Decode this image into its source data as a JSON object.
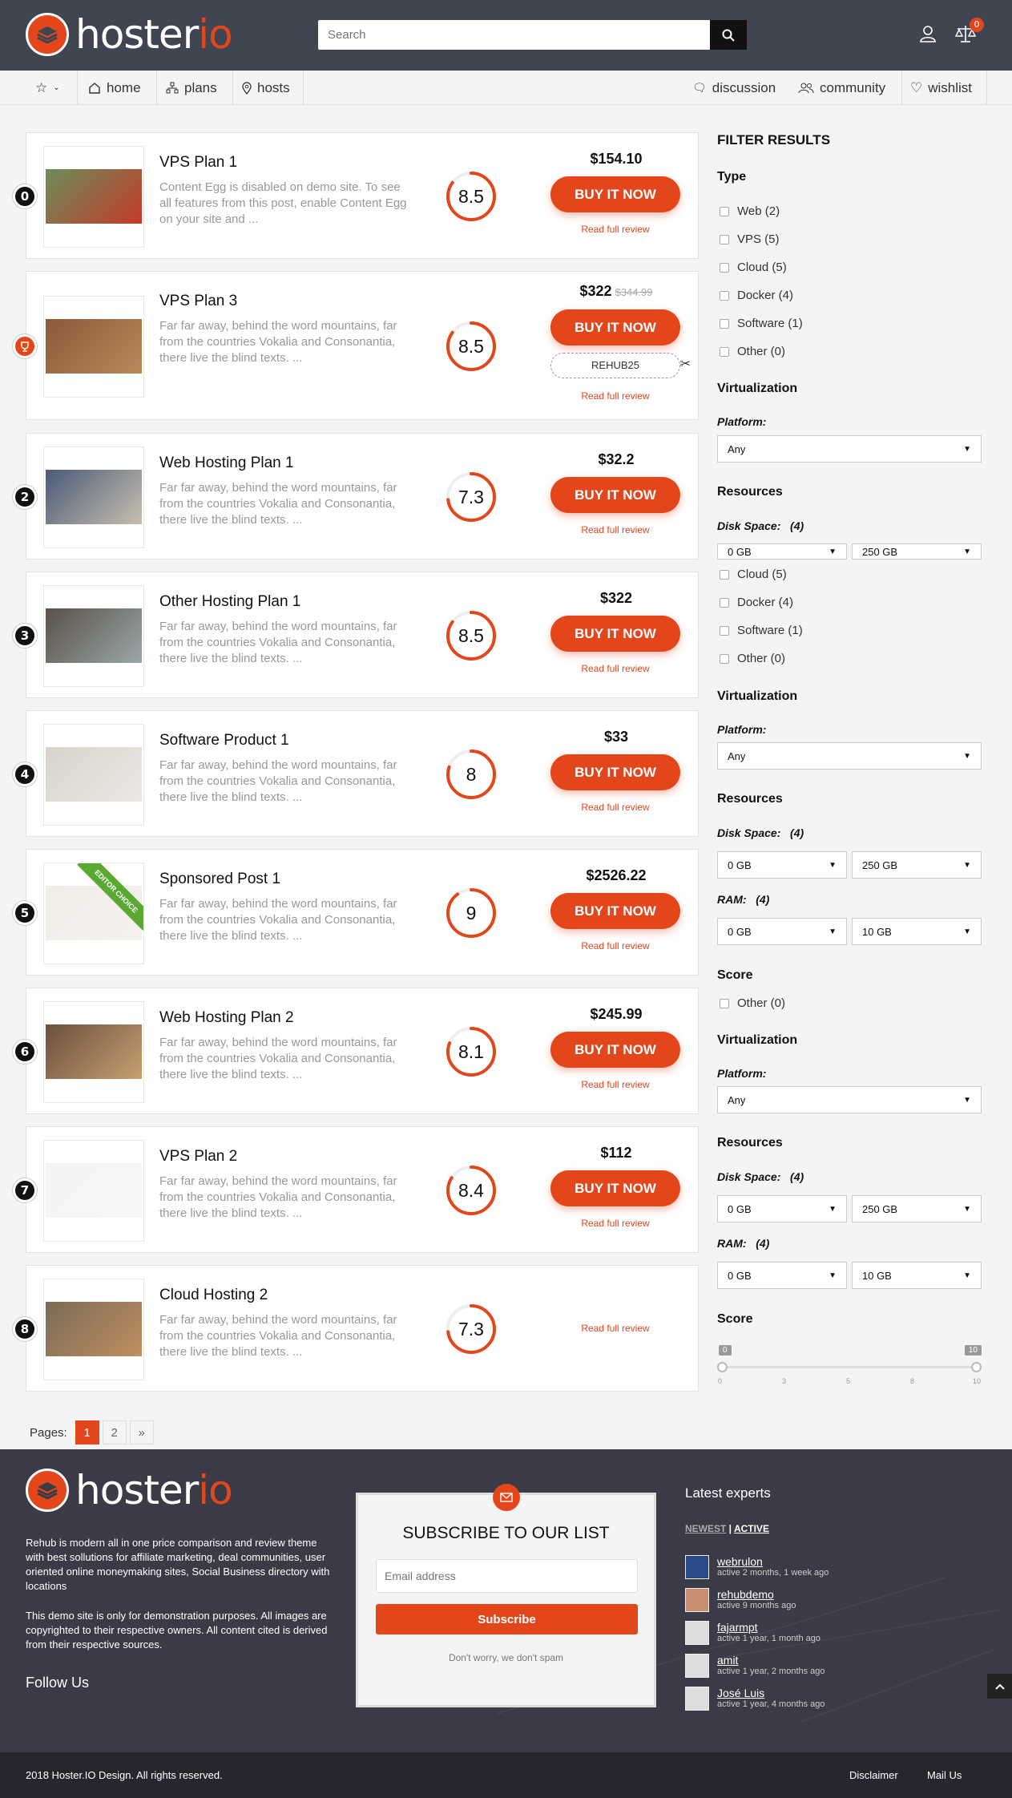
{
  "header": {
    "logo_main": "hoster",
    "logo_accent": "io",
    "search_placeholder": "Search",
    "cart_count": "0"
  },
  "nav": {
    "left": [
      {
        "label": "home",
        "icon": "home-icon"
      },
      {
        "label": "plans",
        "icon": "sitemap-icon"
      },
      {
        "label": "hosts",
        "icon": "map-pin-icon"
      }
    ],
    "right": [
      {
        "label": "discussion",
        "icon": "chat-icon"
      },
      {
        "label": "community",
        "icon": "users-icon"
      },
      {
        "label": "wishlist",
        "icon": "heart-icon"
      }
    ]
  },
  "products": [
    {
      "rank": "0",
      "title": "VPS Plan 1",
      "desc": "Content Egg is disabled on demo site. To see all features from this post, enable Content Egg on your site and ...",
      "score": "8.5",
      "score_value": 8.5,
      "price": "$154.10",
      "old_price": "",
      "buy": "BUY IT NOW",
      "coupon": "",
      "review": "Read full review"
    },
    {
      "rank": "",
      "title": "VPS Plan 3",
      "desc": "Far far away, behind the word mountains, far from the countries Vokalia and Consonantia, there live the blind texts. ...",
      "score": "8.5",
      "score_value": 8.5,
      "price": "$322",
      "old_price": "$344.99",
      "buy": "BUY IT NOW",
      "coupon": "REHUB25",
      "review": "Read full review"
    },
    {
      "rank": "2",
      "title": "Web Hosting Plan 1",
      "desc": "Far far away, behind the word mountains, far from the countries Vokalia and Consonantia, there live the blind texts. ...",
      "score": "7.3",
      "score_value": 7.3,
      "price": "$32.2",
      "old_price": "",
      "buy": "BUY IT NOW",
      "coupon": "",
      "review": "Read full review"
    },
    {
      "rank": "3",
      "title": "Other Hosting Plan 1",
      "desc": "Far far away, behind the word mountains, far from the countries Vokalia and Consonantia, there live the blind texts. ...",
      "score": "8.5",
      "score_value": 8.5,
      "price": "$322",
      "old_price": "",
      "buy": "BUY IT NOW",
      "coupon": "",
      "review": "Read full review"
    },
    {
      "rank": "4",
      "title": "Software Product 1",
      "desc": "Far far away, behind the word mountains, far from the countries Vokalia and Consonantia, there live the blind texts. ...",
      "score": "8",
      "score_value": 8,
      "price": "$33",
      "old_price": "",
      "buy": "BUY IT NOW",
      "coupon": "",
      "review": "Read full review"
    },
    {
      "rank": "5",
      "title": "Sponsored Post 1",
      "desc": "Far far away, behind the word mountains, far from the countries Vokalia and Consonantia, there live the blind texts. ...",
      "score": "9",
      "score_value": 9,
      "price": "$2526.22",
      "old_price": "",
      "buy": "BUY IT NOW",
      "coupon": "",
      "review": "Read full review",
      "ribbon": "EDITOR CHOICE"
    },
    {
      "rank": "6",
      "title": "Web Hosting Plan 2",
      "desc": "Far far away, behind the word mountains, far from the countries Vokalia and Consonantia, there live the blind texts. ...",
      "score": "8.1",
      "score_value": 8.1,
      "price": "$245.99",
      "old_price": "",
      "buy": "BUY IT NOW",
      "coupon": "",
      "review": "Read full review"
    },
    {
      "rank": "7",
      "title": "VPS Plan 2",
      "desc": "Far far away, behind the word mountains, far from the countries Vokalia and Consonantia, there live the blind texts. ...",
      "score": "8.4",
      "score_value": 8.4,
      "price": "$112",
      "old_price": "",
      "buy": "BUY IT NOW",
      "coupon": "",
      "review": "Read full review"
    },
    {
      "rank": "8",
      "title": "Cloud Hosting 2",
      "desc": "Far far away, behind the word mountains, far from the countries Vokalia and Consonantia, there live the blind texts. ...",
      "score": "7.3",
      "score_value": 7.3,
      "price": "",
      "old_price": "",
      "buy": "",
      "coupon": "",
      "review": "Read full review"
    }
  ],
  "sidebar": {
    "title": "FILTER RESULTS",
    "type_heading": "Type",
    "types": [
      "Web (2)",
      "VPS (5)",
      "Cloud (5)",
      "Docker (4)",
      "Software (1)",
      "Other (0)"
    ],
    "types_repeat": [
      "Cloud (5)",
      "Docker (4)",
      "Software (1)",
      "Other (0)"
    ],
    "virtualization": "Virtualization",
    "platform": "Platform:",
    "platform_value": "Any",
    "resources": "Resources",
    "disk_space": "Disk Space:",
    "disk_count": "(4)",
    "disk_min": "0 GB",
    "disk_max": "250 GB",
    "ram": "RAM:",
    "ram_count": "(4)",
    "ram_min": "0 GB",
    "ram_max": "10 GB",
    "score": "Score",
    "other": "Other (0)",
    "slider_min": "0",
    "slider_max": "10",
    "slider_ticks": [
      "0",
      "3",
      "5",
      "8",
      "10"
    ]
  },
  "pager": {
    "label": "Pages:",
    "pages": [
      "1",
      "2"
    ],
    "next": "»"
  },
  "footer": {
    "about1": "Rehub is modern all in one price comparison and review theme with best sollutions for affiliate marketing, deal communities, user oriented online moneymaking sites, Social Business directory with locations",
    "about2": "This demo site is only for demonstration purposes. All images are copyrighted to their respective owners. All content cited is derived from their respective sources.",
    "follow": "Follow Us",
    "subscribe_title": "SUBSCRIBE TO OUR LIST",
    "email_placeholder": "Email address",
    "subscribe_btn": "Subscribe",
    "no_spam": "Don't worry, we don't spam",
    "experts_title": "Latest experts",
    "tab_newest": "NEWEST",
    "tab_active": "ACTIVE",
    "experts": [
      {
        "name": "webrulon",
        "status": "active 2 months, 1 week ago"
      },
      {
        "name": "rehubdemo",
        "status": "active 9 months ago"
      },
      {
        "name": "fajarmpt",
        "status": "active 1 year, 1 month ago"
      },
      {
        "name": "amit",
        "status": "active 1 year, 2 months ago"
      },
      {
        "name": "José Luis",
        "status": "active 1 year, 4 months ago"
      }
    ],
    "copyright": "2018 Hoster.IO Design. All rights reserved.",
    "disclaimer": "Disclaimer",
    "mail": "Mail Us"
  },
  "colors": {
    "accent": "#e4461c",
    "header": "#3f4551",
    "footer": "#3b3a47",
    "ribbon": "#5aa832"
  }
}
